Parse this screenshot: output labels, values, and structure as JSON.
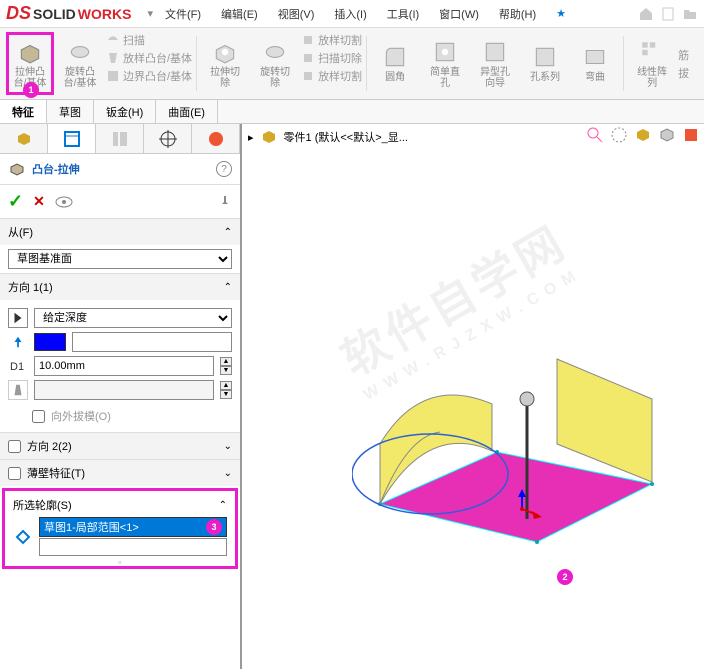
{
  "app": {
    "name_solid": "SOLID",
    "name_works": "WORKS"
  },
  "menu": {
    "file": "文件(F)",
    "edit": "编辑(E)",
    "view": "视图(V)",
    "insert": "插入(I)",
    "tools": "工具(I)",
    "window": "窗口(W)",
    "help": "帮助(H)",
    "star": "★"
  },
  "ribbon": {
    "extrude": "拉伸凸\n台/基体",
    "revolve": "旋转凸\n台/基体",
    "sweep": "扫描",
    "loft": "放样凸台/基体",
    "boundary": "边界凸台/基体",
    "cut_extrude": "拉伸切\n除",
    "cut_revolve": "旋转切\n除",
    "cut_sweep": "放样切割",
    "cut_loft": "扫描切除",
    "cut_boundary": "放样切割",
    "fillet": "圆角",
    "rib": "简单直\n孔",
    "shell": "异型孔\n向导",
    "hole": "孔系列",
    "wrap": "弯曲",
    "pattern": "线性阵\n列",
    "draft": "筋",
    "ext": "拔"
  },
  "tabs": {
    "feature": "特征",
    "sketch": "草图",
    "sheetmetal": "钣金(H)",
    "surface": "曲面(E)"
  },
  "breadcrumb": {
    "part": "零件1  (默认<<默认>_显..."
  },
  "feature": {
    "title": "凸台-拉伸",
    "from": "从(F)",
    "from_value": "草图基准面",
    "dir1": "方向 1(1)",
    "dir1_type": "给定深度",
    "dir1_depth": "10.00mm",
    "draft_out": "向外拔模(O)",
    "dir2": "方向 2(2)",
    "thin": "薄壁特征(T)",
    "contour": "所选轮廓(S)",
    "contour_item": "草图1-局部范围<1>"
  },
  "badges": {
    "b1": "1",
    "b2": "2",
    "b3": "3"
  }
}
